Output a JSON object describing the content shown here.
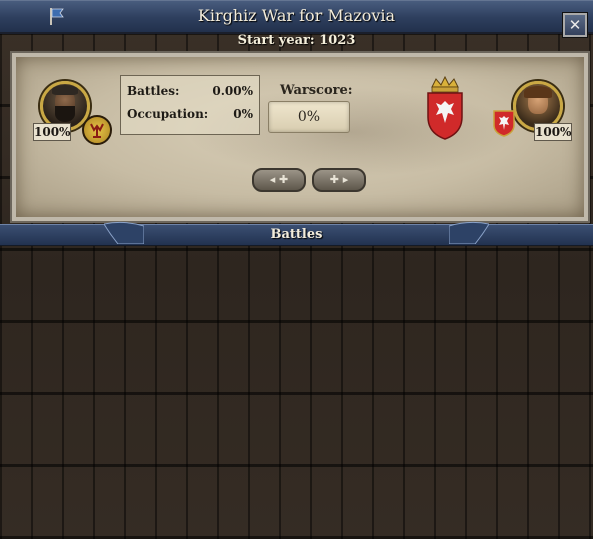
{
  "window": {
    "title": "Kirghiz War for Mazovia",
    "start_year": "Start year: 1023",
    "close_label": "✕"
  },
  "attacker": {
    "war_contribution": "100%",
    "stats": {
      "battles_label": "Battles:",
      "battles_value": "0.00%",
      "occupation_label": "Occupation:",
      "occupation_value": "0%"
    }
  },
  "warscore": {
    "label": "Warscore:",
    "value": "0%"
  },
  "defender": {
    "war_contribution": "100%"
  },
  "navigation": {
    "prev_label": "◂ ✚",
    "next_label": "✚ ▸"
  },
  "battles_section": {
    "title": "Battles"
  },
  "icons": {
    "title_icon": "war-banner-icon",
    "close_icon": "close-icon",
    "attacker_religion": "tengri-religion-icon",
    "defender_coat_of_arms": "polish-eagle-coat-of-arms-icon"
  },
  "colors": {
    "title_bar": "#2e3f5e",
    "panel_parchment": "#c7bca4",
    "portrait_frame": "#c9a844",
    "coat_of_arms_red": "#d02a2a"
  }
}
